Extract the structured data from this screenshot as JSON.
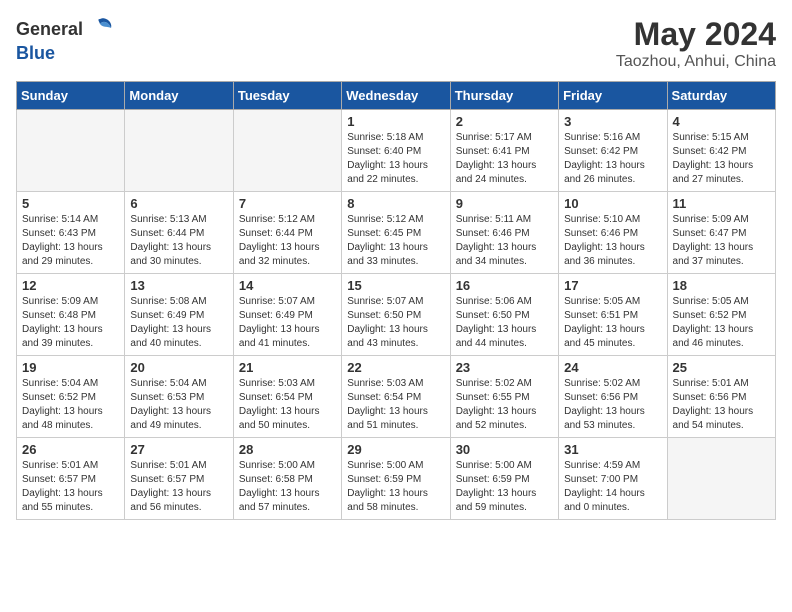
{
  "header": {
    "logo_general": "General",
    "logo_blue": "Blue",
    "month_year": "May 2024",
    "location": "Taozhou, Anhui, China"
  },
  "days_of_week": [
    "Sunday",
    "Monday",
    "Tuesday",
    "Wednesday",
    "Thursday",
    "Friday",
    "Saturday"
  ],
  "weeks": [
    [
      {
        "day": "",
        "info": ""
      },
      {
        "day": "",
        "info": ""
      },
      {
        "day": "",
        "info": ""
      },
      {
        "day": "1",
        "info": "Sunrise: 5:18 AM\nSunset: 6:40 PM\nDaylight: 13 hours\nand 22 minutes."
      },
      {
        "day": "2",
        "info": "Sunrise: 5:17 AM\nSunset: 6:41 PM\nDaylight: 13 hours\nand 24 minutes."
      },
      {
        "day": "3",
        "info": "Sunrise: 5:16 AM\nSunset: 6:42 PM\nDaylight: 13 hours\nand 26 minutes."
      },
      {
        "day": "4",
        "info": "Sunrise: 5:15 AM\nSunset: 6:42 PM\nDaylight: 13 hours\nand 27 minutes."
      }
    ],
    [
      {
        "day": "5",
        "info": "Sunrise: 5:14 AM\nSunset: 6:43 PM\nDaylight: 13 hours\nand 29 minutes."
      },
      {
        "day": "6",
        "info": "Sunrise: 5:13 AM\nSunset: 6:44 PM\nDaylight: 13 hours\nand 30 minutes."
      },
      {
        "day": "7",
        "info": "Sunrise: 5:12 AM\nSunset: 6:44 PM\nDaylight: 13 hours\nand 32 minutes."
      },
      {
        "day": "8",
        "info": "Sunrise: 5:12 AM\nSunset: 6:45 PM\nDaylight: 13 hours\nand 33 minutes."
      },
      {
        "day": "9",
        "info": "Sunrise: 5:11 AM\nSunset: 6:46 PM\nDaylight: 13 hours\nand 34 minutes."
      },
      {
        "day": "10",
        "info": "Sunrise: 5:10 AM\nSunset: 6:46 PM\nDaylight: 13 hours\nand 36 minutes."
      },
      {
        "day": "11",
        "info": "Sunrise: 5:09 AM\nSunset: 6:47 PM\nDaylight: 13 hours\nand 37 minutes."
      }
    ],
    [
      {
        "day": "12",
        "info": "Sunrise: 5:09 AM\nSunset: 6:48 PM\nDaylight: 13 hours\nand 39 minutes."
      },
      {
        "day": "13",
        "info": "Sunrise: 5:08 AM\nSunset: 6:49 PM\nDaylight: 13 hours\nand 40 minutes."
      },
      {
        "day": "14",
        "info": "Sunrise: 5:07 AM\nSunset: 6:49 PM\nDaylight: 13 hours\nand 41 minutes."
      },
      {
        "day": "15",
        "info": "Sunrise: 5:07 AM\nSunset: 6:50 PM\nDaylight: 13 hours\nand 43 minutes."
      },
      {
        "day": "16",
        "info": "Sunrise: 5:06 AM\nSunset: 6:50 PM\nDaylight: 13 hours\nand 44 minutes."
      },
      {
        "day": "17",
        "info": "Sunrise: 5:05 AM\nSunset: 6:51 PM\nDaylight: 13 hours\nand 45 minutes."
      },
      {
        "day": "18",
        "info": "Sunrise: 5:05 AM\nSunset: 6:52 PM\nDaylight: 13 hours\nand 46 minutes."
      }
    ],
    [
      {
        "day": "19",
        "info": "Sunrise: 5:04 AM\nSunset: 6:52 PM\nDaylight: 13 hours\nand 48 minutes."
      },
      {
        "day": "20",
        "info": "Sunrise: 5:04 AM\nSunset: 6:53 PM\nDaylight: 13 hours\nand 49 minutes."
      },
      {
        "day": "21",
        "info": "Sunrise: 5:03 AM\nSunset: 6:54 PM\nDaylight: 13 hours\nand 50 minutes."
      },
      {
        "day": "22",
        "info": "Sunrise: 5:03 AM\nSunset: 6:54 PM\nDaylight: 13 hours\nand 51 minutes."
      },
      {
        "day": "23",
        "info": "Sunrise: 5:02 AM\nSunset: 6:55 PM\nDaylight: 13 hours\nand 52 minutes."
      },
      {
        "day": "24",
        "info": "Sunrise: 5:02 AM\nSunset: 6:56 PM\nDaylight: 13 hours\nand 53 minutes."
      },
      {
        "day": "25",
        "info": "Sunrise: 5:01 AM\nSunset: 6:56 PM\nDaylight: 13 hours\nand 54 minutes."
      }
    ],
    [
      {
        "day": "26",
        "info": "Sunrise: 5:01 AM\nSunset: 6:57 PM\nDaylight: 13 hours\nand 55 minutes."
      },
      {
        "day": "27",
        "info": "Sunrise: 5:01 AM\nSunset: 6:57 PM\nDaylight: 13 hours\nand 56 minutes."
      },
      {
        "day": "28",
        "info": "Sunrise: 5:00 AM\nSunset: 6:58 PM\nDaylight: 13 hours\nand 57 minutes."
      },
      {
        "day": "29",
        "info": "Sunrise: 5:00 AM\nSunset: 6:59 PM\nDaylight: 13 hours\nand 58 minutes."
      },
      {
        "day": "30",
        "info": "Sunrise: 5:00 AM\nSunset: 6:59 PM\nDaylight: 13 hours\nand 59 minutes."
      },
      {
        "day": "31",
        "info": "Sunrise: 4:59 AM\nSunset: 7:00 PM\nDaylight: 14 hours\nand 0 minutes."
      },
      {
        "day": "",
        "info": ""
      }
    ]
  ]
}
